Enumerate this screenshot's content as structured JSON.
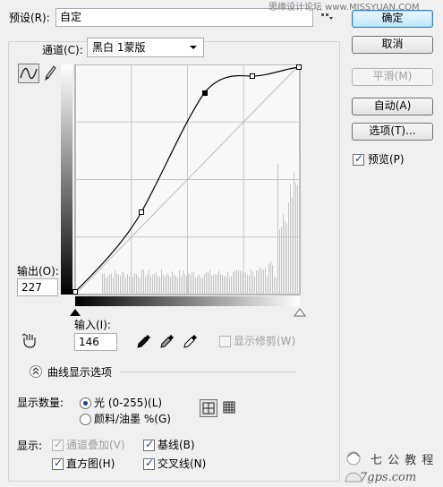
{
  "preset": {
    "label": "预设(R):",
    "value": "自定"
  },
  "watermark_top": "思缘设计论坛  www.MISSYUAN.COM",
  "channel": {
    "label": "通道(C):",
    "value": "黑白 1蒙版"
  },
  "buttons": {
    "ok": "确定",
    "cancel": "取消",
    "smooth": "平滑(M)",
    "auto": "自动(A)",
    "options": "选项(T)..."
  },
  "preview": {
    "label": "预览(P)",
    "checked": true
  },
  "output": {
    "label": "输出(O):",
    "value": "227"
  },
  "input": {
    "label": "输入(I):",
    "value": "146"
  },
  "show_clipping": {
    "label": "显示修剪(W)",
    "checked": false
  },
  "curve_display": {
    "label": "曲线显示选项"
  },
  "show_amount": {
    "label": "显示数量:",
    "options": [
      "光 (0-255)(L)",
      "颜料/油墨 %(G)"
    ],
    "selected": 0
  },
  "show": {
    "label": "显示:",
    "overlay": "通道叠加(V)",
    "baseline": "基线(B)",
    "histogram": "直方图(H)",
    "intersection": "交叉线(N)"
  },
  "watermark_bottom": {
    "brand": "七 公 教 程",
    "site": "7gps.com"
  },
  "colors": {
    "accent": "#3c7fb1",
    "curve": "#000000",
    "grid": "#c8c8c8",
    "histogram": "#c4c4c4"
  },
  "icons": [
    "curve-tool-icon",
    "pencil-icon",
    "hand-adjust-icon",
    "black-eyedropper-icon",
    "gray-eyedropper-icon",
    "white-eyedropper-icon",
    "collapse-chevron-icon",
    "grid-4-icon",
    "grid-10-icon"
  ]
}
